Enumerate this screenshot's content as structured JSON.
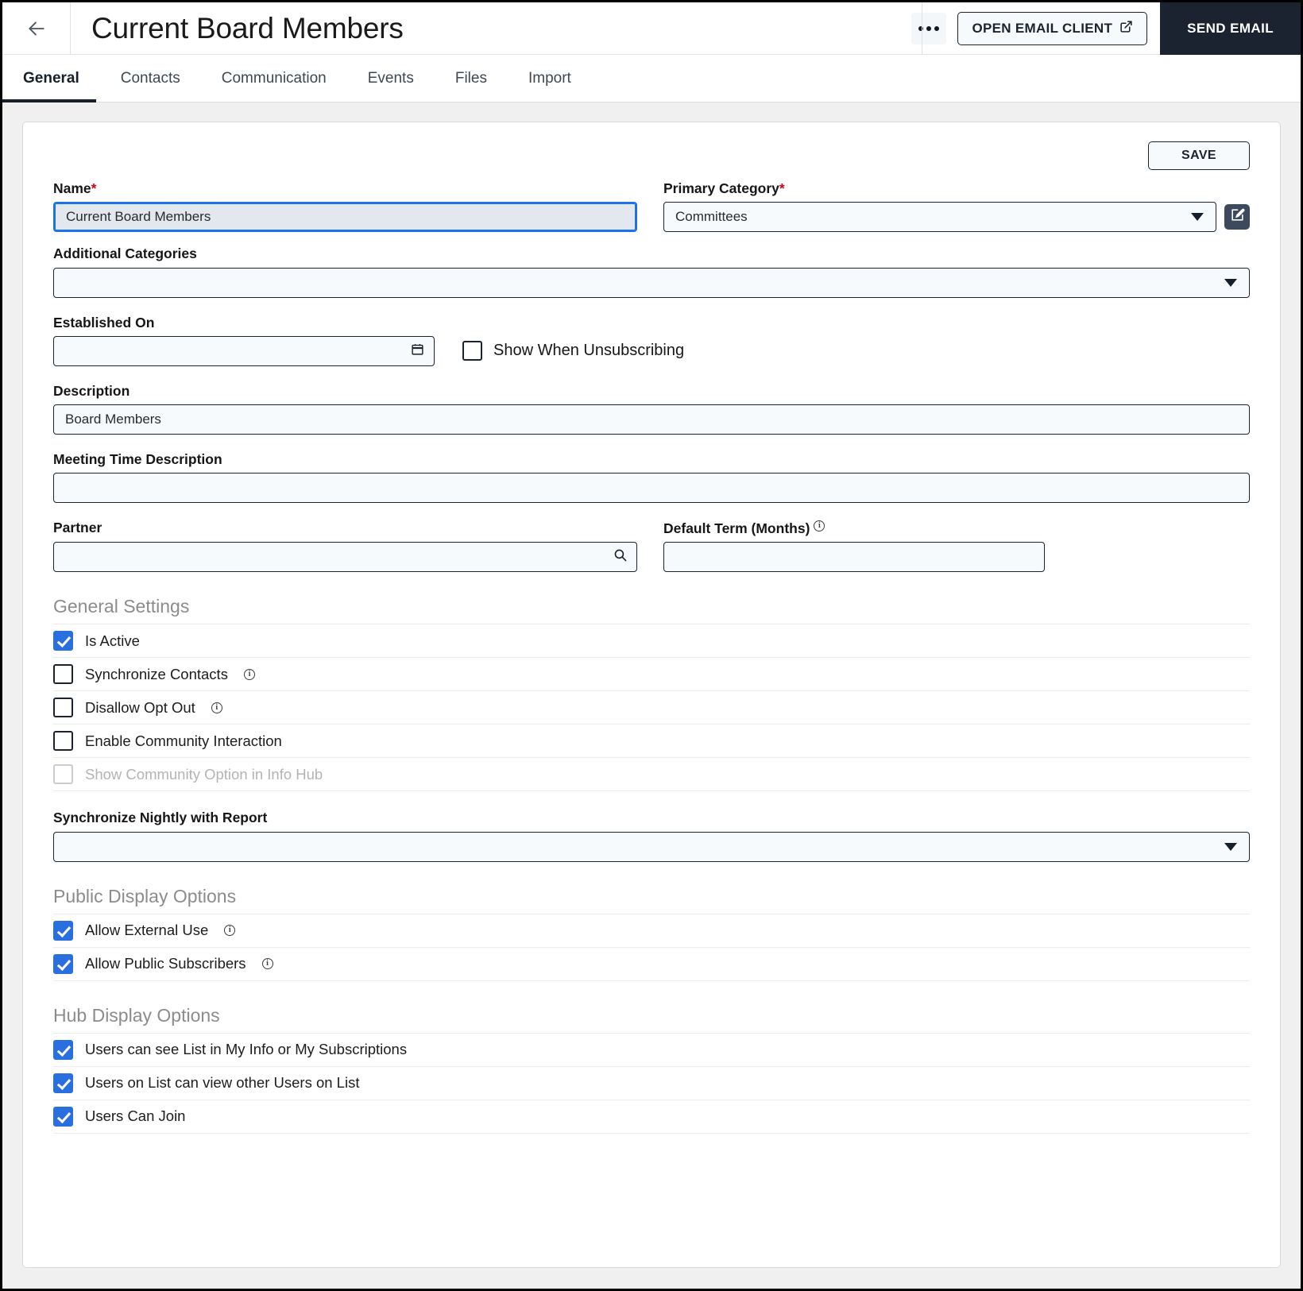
{
  "header": {
    "back_icon": "arrow-left-icon",
    "title": "Current Board Members",
    "kebab_icon": "more-options-icon",
    "open_email_label": "OPEN EMAIL CLIENT",
    "open_email_icon": "external-link-icon",
    "send_email_label": "SEND EMAIL"
  },
  "tabs": [
    {
      "label": "General",
      "active": true
    },
    {
      "label": "Contacts",
      "active": false
    },
    {
      "label": "Communication",
      "active": false
    },
    {
      "label": "Events",
      "active": false
    },
    {
      "label": "Files",
      "active": false
    },
    {
      "label": "Import",
      "active": false
    }
  ],
  "form": {
    "save_label": "SAVE",
    "name": {
      "label": "Name",
      "required_mark": "*",
      "value": "Current Board Members",
      "placeholder": ""
    },
    "primary_category": {
      "label": "Primary Category",
      "required_mark": "*",
      "value": "Committees",
      "placeholder": "",
      "edit_icon": "edit-square-icon",
      "caret_icon": "chevron-down-icon"
    },
    "additional_categories": {
      "label": "Additional Categories",
      "value": "",
      "placeholder": "",
      "caret_icon": "chevron-down-icon"
    },
    "established_on": {
      "label": "Established On",
      "value": "",
      "placeholder": "",
      "calendar_icon": "calendar-icon"
    },
    "show_when_unsubscribing": {
      "label": "Show When Unsubscribing",
      "checked": false
    },
    "description": {
      "label": "Description",
      "value": "Board Members",
      "placeholder": ""
    },
    "meeting_time_description": {
      "label": "Meeting Time Description",
      "value": "",
      "placeholder": ""
    },
    "partner": {
      "label": "Partner",
      "value": "",
      "placeholder": "",
      "search_icon": "search-icon"
    },
    "default_term": {
      "label": "Default Term (Months)",
      "value": "",
      "placeholder": "",
      "info_icon": "info-icon"
    },
    "general_settings": {
      "title": "General Settings",
      "items": [
        {
          "label": "Is Active",
          "checked": true,
          "info": false,
          "disabled": false
        },
        {
          "label": "Synchronize Contacts",
          "checked": false,
          "info": true,
          "disabled": false
        },
        {
          "label": "Disallow Opt Out",
          "checked": false,
          "info": true,
          "disabled": false
        },
        {
          "label": "Enable Community Interaction",
          "checked": false,
          "info": false,
          "disabled": false
        },
        {
          "label": "Show Community Option in Info Hub",
          "checked": false,
          "info": false,
          "disabled": true
        }
      ]
    },
    "synchronize_nightly": {
      "label": "Synchronize Nightly with Report",
      "value": "",
      "placeholder": "",
      "caret_icon": "chevron-down-icon"
    },
    "public_display_options": {
      "title": "Public Display Options",
      "items": [
        {
          "label": "Allow External Use",
          "checked": true,
          "info": true,
          "disabled": false
        },
        {
          "label": "Allow Public Subscribers",
          "checked": true,
          "info": true,
          "disabled": false
        }
      ]
    },
    "hub_display_options": {
      "title": "Hub Display Options",
      "items": [
        {
          "label": "Users can see List in My Info or My Subscriptions",
          "checked": true,
          "info": false,
          "disabled": false
        },
        {
          "label": "Users on List can view other Users on List",
          "checked": true,
          "info": false,
          "disabled": false
        },
        {
          "label": "Users Can Join",
          "checked": true,
          "info": false,
          "disabled": false
        }
      ]
    }
  },
  "colors": {
    "accent_blue": "#2a6fe0",
    "dark": "#1b2330",
    "required_red": "#d0021b",
    "field_bg": "#f7fafc",
    "focus_blue": "#1a73e8"
  }
}
